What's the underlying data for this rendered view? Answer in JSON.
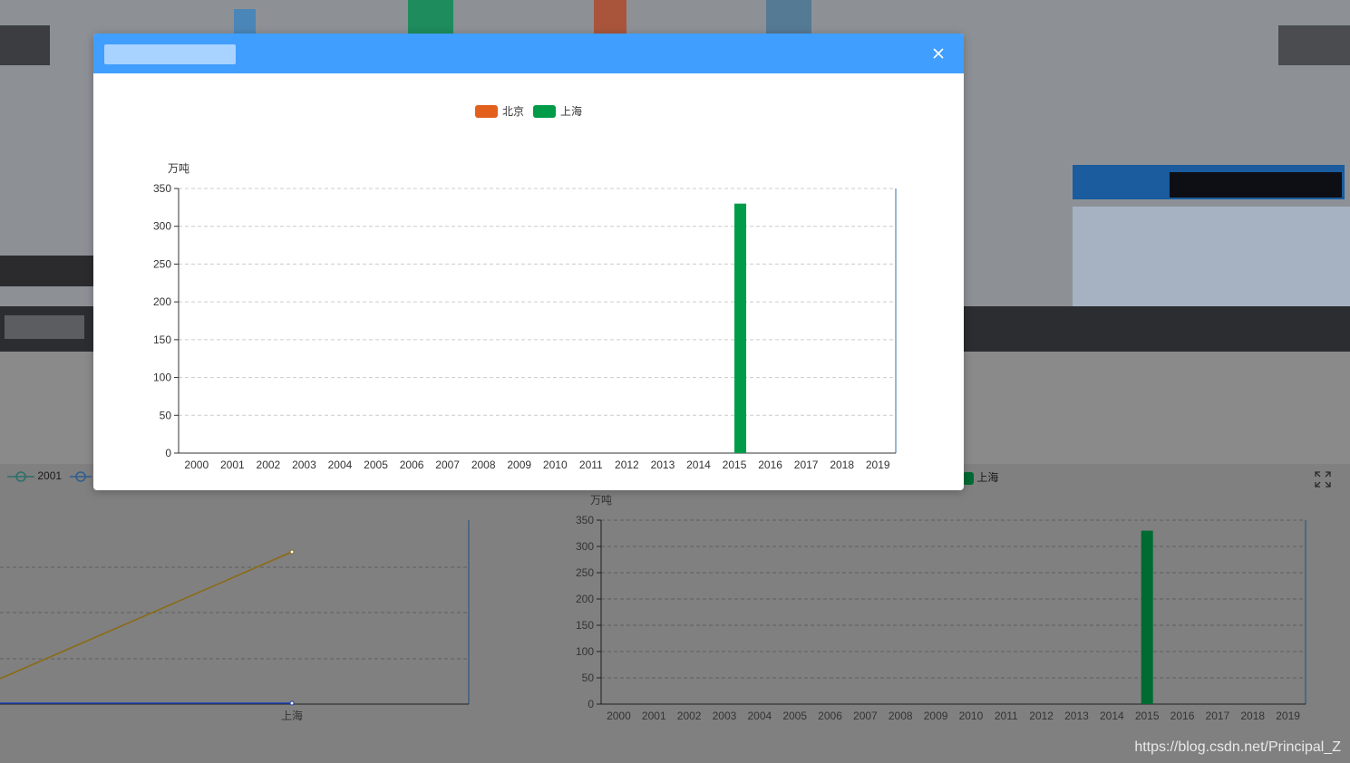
{
  "legend_series": [
    {
      "name": "北京",
      "color": "#e35f1c"
    },
    {
      "name": "上海",
      "color": "#009b48"
    }
  ],
  "chart_data": [
    {
      "type": "bar",
      "ylabel": "万吨",
      "categories": [
        "2000",
        "2001",
        "2002",
        "2003",
        "2004",
        "2005",
        "2006",
        "2007",
        "2008",
        "2009",
        "2010",
        "2011",
        "2012",
        "2013",
        "2014",
        "2015",
        "2016",
        "2017",
        "2018",
        "2019"
      ],
      "series": [
        {
          "name": "北京",
          "values": [
            0,
            0,
            0,
            0,
            0,
            0,
            0,
            0,
            0,
            0,
            0,
            0,
            0,
            0,
            0,
            0,
            0,
            0,
            0,
            0
          ]
        },
        {
          "name": "上海",
          "values": [
            0,
            0,
            0,
            0,
            0,
            0,
            0,
            0,
            0,
            0,
            0,
            0,
            0,
            0,
            0,
            330,
            0,
            0,
            0,
            0
          ]
        }
      ],
      "ylim": [
        0,
        350
      ],
      "yticks": [
        0,
        50,
        100,
        150,
        200,
        250,
        300,
        350
      ],
      "grid": true,
      "legend": "top"
    },
    {
      "type": "bar",
      "ylabel": "万吨",
      "categories": [
        "2000",
        "2001",
        "2002",
        "2003",
        "2004",
        "2005",
        "2006",
        "2007",
        "2008",
        "2009",
        "2010",
        "2011",
        "2012",
        "2013",
        "2014",
        "2015",
        "2016",
        "2017",
        "2018",
        "2019"
      ],
      "series": [
        {
          "name": "上海",
          "values": [
            0,
            0,
            0,
            0,
            0,
            0,
            0,
            0,
            0,
            0,
            0,
            0,
            0,
            0,
            0,
            330,
            0,
            0,
            0,
            0
          ]
        }
      ],
      "ylim": [
        0,
        350
      ],
      "yticks": [
        0,
        50,
        100,
        150,
        200,
        250,
        300,
        350
      ],
      "grid": true,
      "legend": "top"
    },
    {
      "type": "line",
      "categories": [
        "上海"
      ],
      "series": [
        {
          "name": "2001",
          "values": [
            0
          ]
        }
      ],
      "legend": "top-left"
    }
  ],
  "background": {
    "legend_left_item": "2001",
    "legend_right_item": "上海",
    "watermark": "https://blog.csdn.net/Principal_Z"
  },
  "colors": {
    "header": "#409eff",
    "beijing": "#e35f1c",
    "shanghai": "#009b48",
    "axis_right": "#2f6fb8"
  },
  "icons": {
    "close": "close-icon",
    "fullscreen": "fullscreen-icon"
  }
}
